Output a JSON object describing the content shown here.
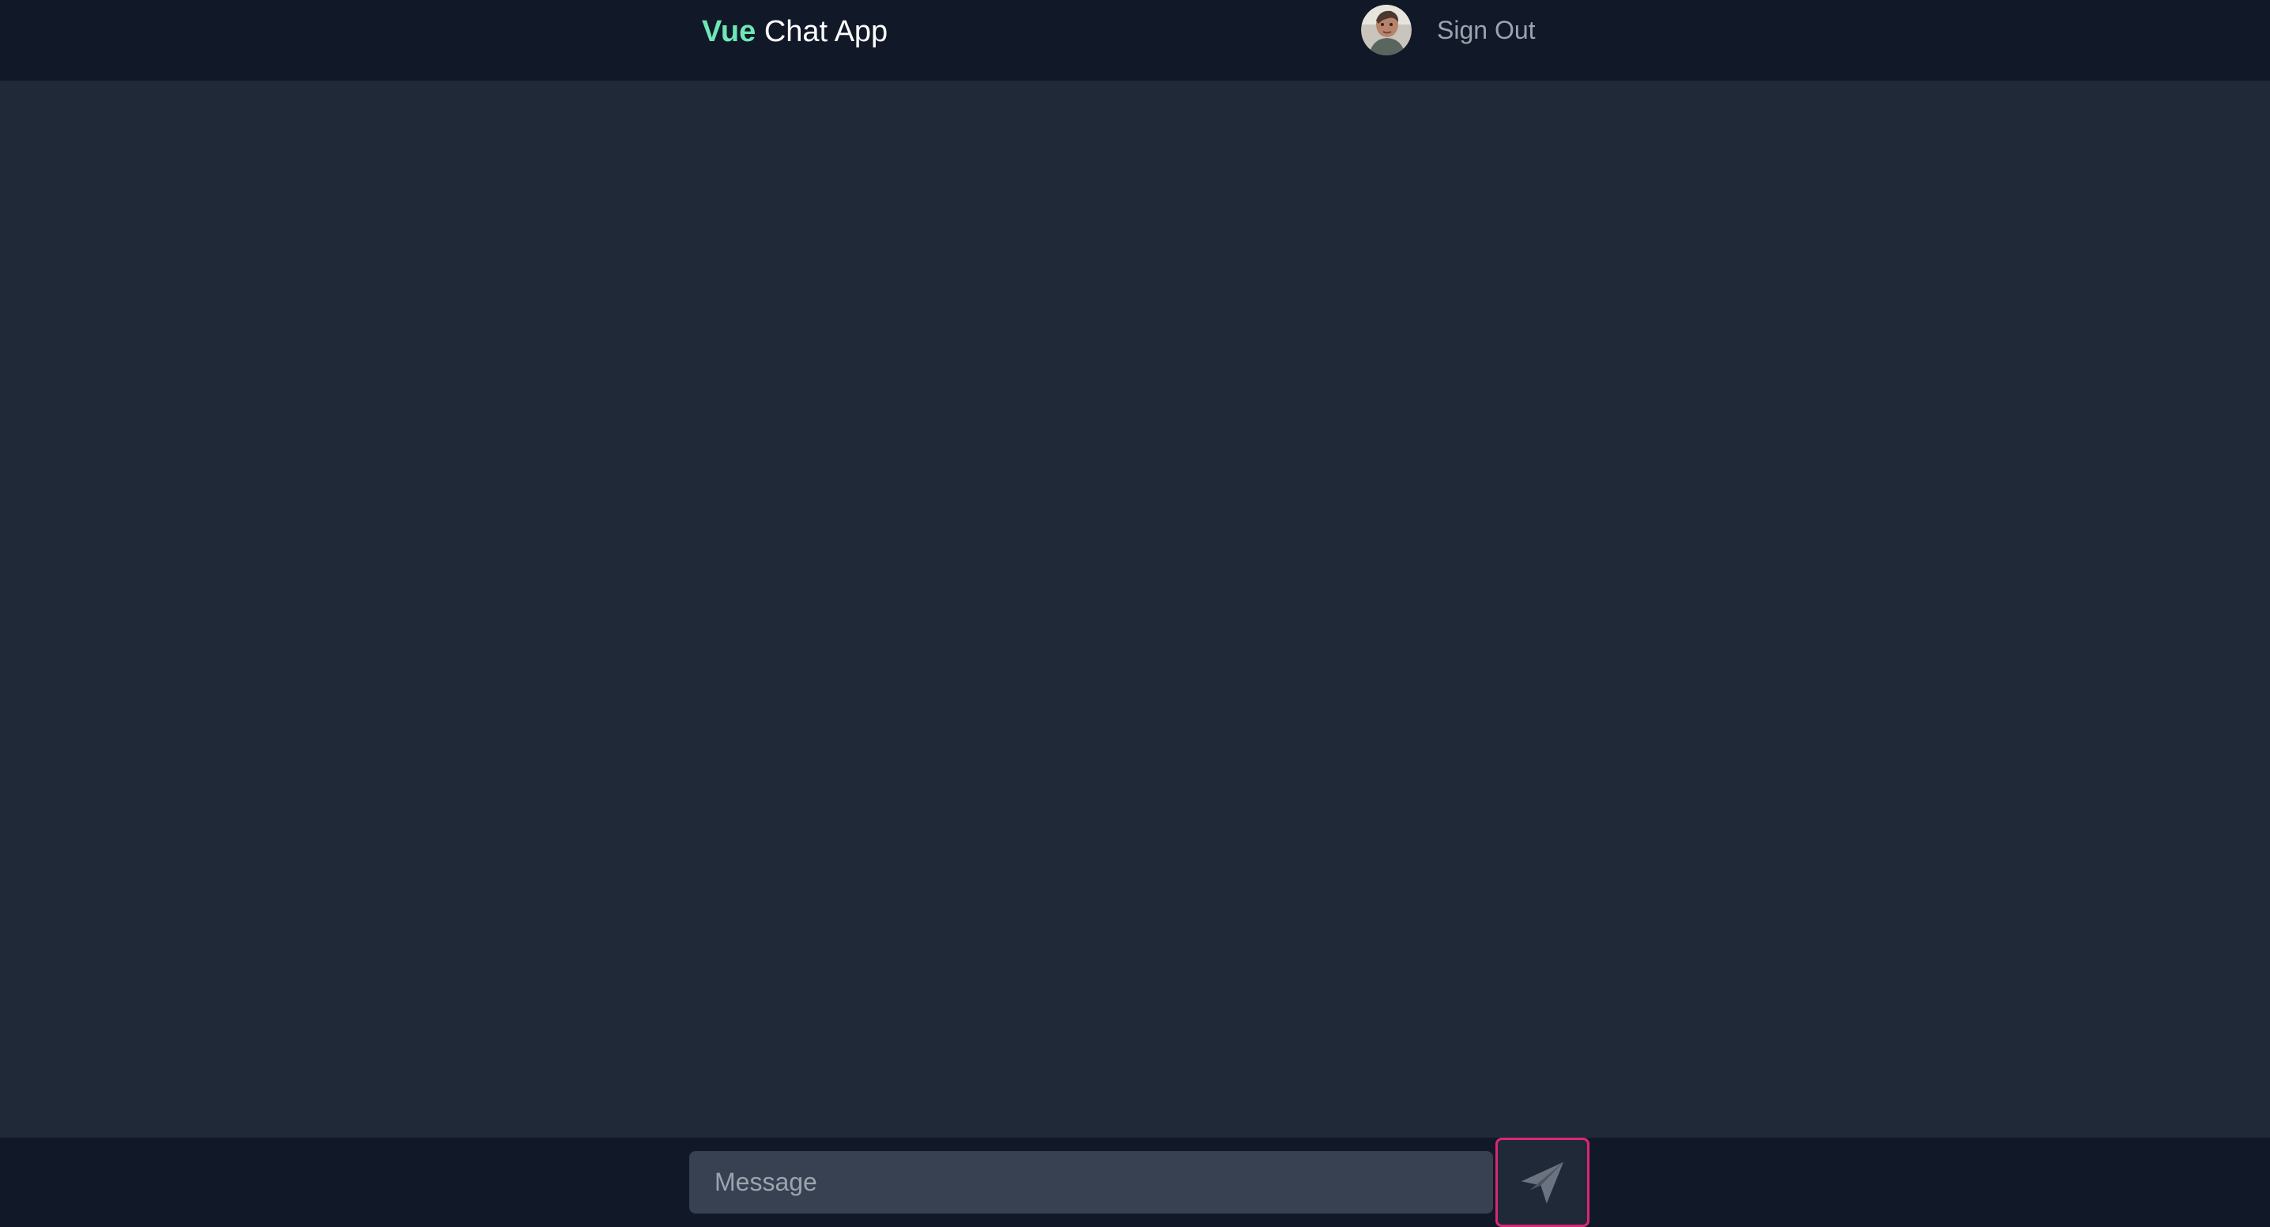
{
  "header": {
    "brand_accent": "Vue",
    "brand_rest": " Chat App",
    "sign_out_label": "Sign Out",
    "avatar_icon": "user-avatar-photo"
  },
  "composer": {
    "placeholder": "Message",
    "send_icon": "paper-plane-icon"
  },
  "colors": {
    "header_background": "#111827",
    "chat_background": "#1f2937",
    "brand_accent": "#6ee7b7",
    "input_background": "#374151",
    "send_button_border": "#db2777",
    "send_icon": "#6b7280"
  }
}
